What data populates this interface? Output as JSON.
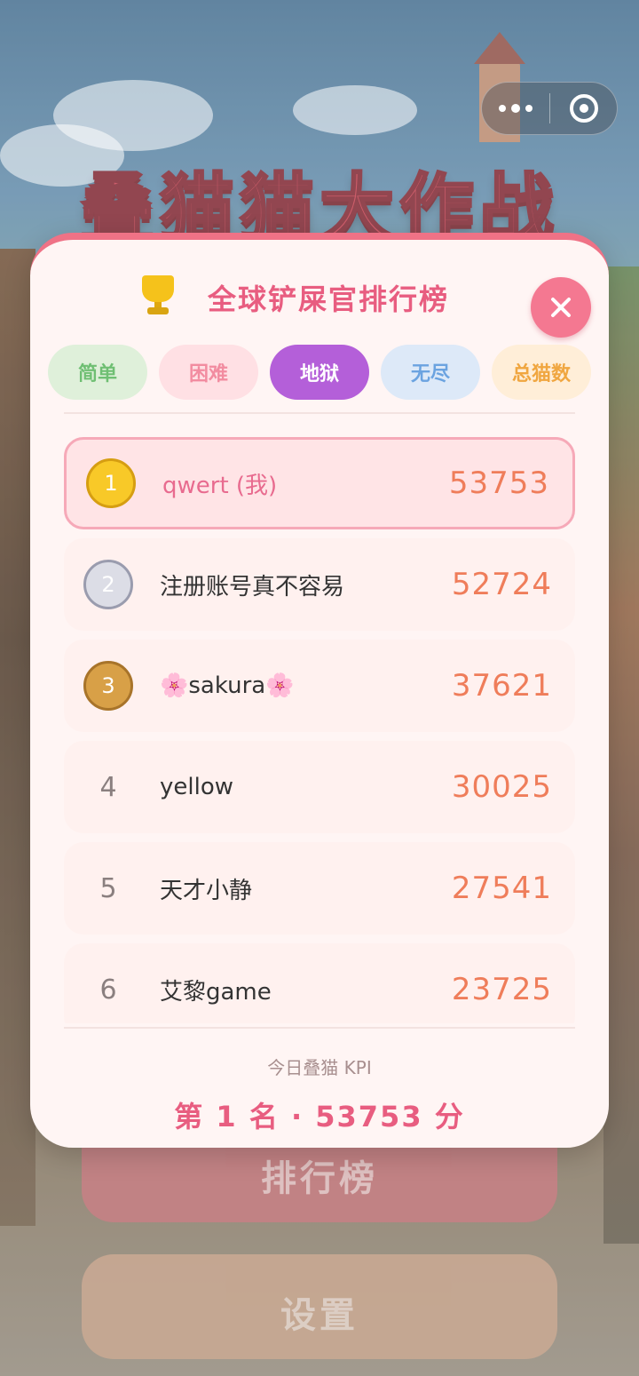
{
  "app": {
    "game_title": "叠猫猫大作战",
    "menu": {
      "rank_button": "排行榜",
      "settings_button": "设置"
    }
  },
  "leaderboard": {
    "title": "全球铲屎官排行榜",
    "trophy_icon": "trophy-icon",
    "close_icon": "close-icon",
    "tabs": [
      {
        "label": "简单",
        "active": false
      },
      {
        "label": "困难",
        "active": false
      },
      {
        "label": "地狱",
        "active": true
      },
      {
        "label": "无尽",
        "active": false
      },
      {
        "label": "总猫数",
        "active": false
      }
    ],
    "entries": [
      {
        "rank": "1",
        "name": "qwert (我)",
        "score": "53753",
        "is_me": true
      },
      {
        "rank": "2",
        "name": "注册账号真不容易",
        "score": "52724",
        "is_me": false
      },
      {
        "rank": "3",
        "name": "🌸sakura🌸",
        "score": "37621",
        "is_me": false
      },
      {
        "rank": "4",
        "name": "yellow",
        "score": "30025",
        "is_me": false
      },
      {
        "rank": "5",
        "name": "天才小静",
        "score": "27541",
        "is_me": false
      },
      {
        "rank": "6",
        "name": "艾黎game",
        "score": "23725",
        "is_me": false
      }
    ],
    "footer": {
      "label": "今日叠猫 KPI",
      "value": "第 1 名 · 53753 分"
    }
  },
  "colors": {
    "accent": "#e85d80",
    "score": "#ef7d5a",
    "active_tab": "#b45fd9",
    "close_button": "#f47891"
  }
}
